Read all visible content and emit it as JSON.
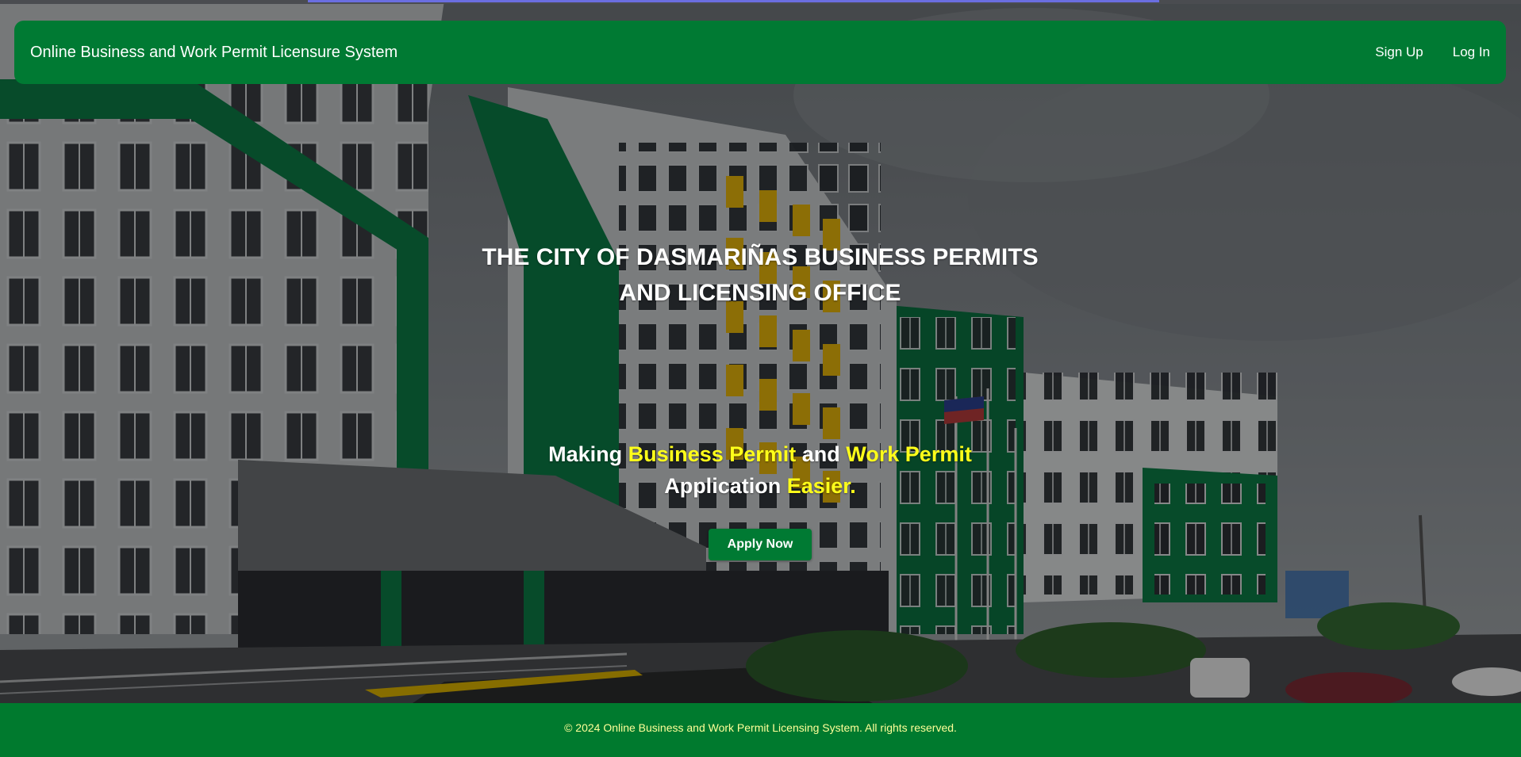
{
  "colors": {
    "brand_green": "#007a33",
    "highlight_yellow": "#ffff1a",
    "footer_text": "#ffff99",
    "text_white": "#ffffff"
  },
  "navbar": {
    "brand": "Online Business and Work Permit Licensure System",
    "signup_label": "Sign Up",
    "login_label": "Log In"
  },
  "hero": {
    "title_line1": "THE CITY OF DASMARIÑAS BUSINESS PERMITS",
    "title_line2": "AND LICENSING OFFICE",
    "tagline": {
      "part1": "Making ",
      "highlight1": "Business Permit",
      "part2": " and ",
      "highlight2": "Work Permit",
      "part3": "Application ",
      "highlight3": "Easier."
    },
    "apply_label": "Apply Now",
    "background_image": "city-hall-building"
  },
  "footer": {
    "text": "© 2024 Online Business and Work Permit Licensing System. All rights reserved."
  }
}
